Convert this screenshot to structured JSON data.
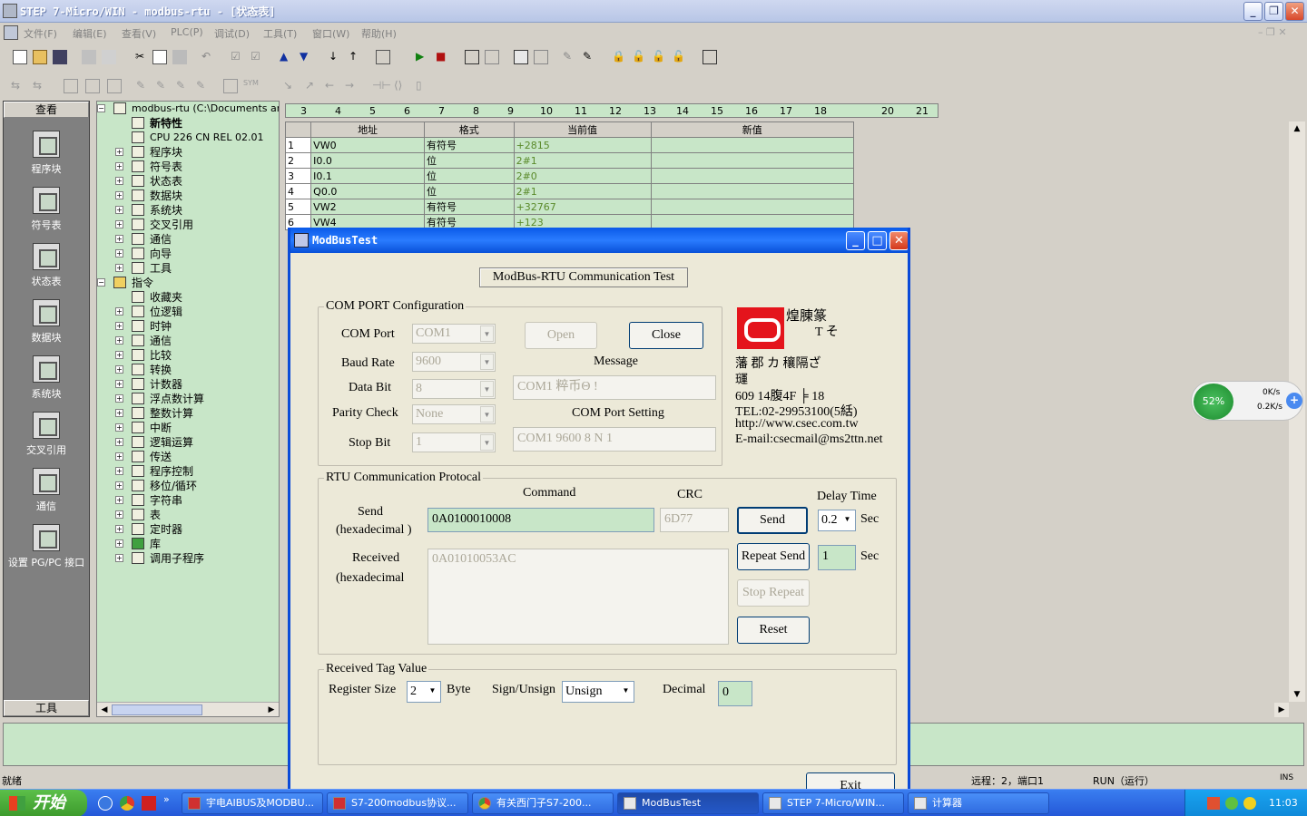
{
  "app": {
    "title": "STEP 7-Micro/WIN - modbus-rtu - [状态表]",
    "menu": [
      "文件(F)",
      "编辑(E)",
      "查看(V)",
      "PLC(P)",
      "调试(D)",
      "工具(T)",
      "窗口(W)",
      "帮助(H)"
    ]
  },
  "navbar": {
    "header": "查看",
    "footer": "工具",
    "items": [
      "程序块",
      "符号表",
      "状态表",
      "数据块",
      "系统块",
      "交叉引用",
      "通信",
      "设置 PG/PC 接口"
    ]
  },
  "tree": {
    "root": "modbus-rtu (C:\\Documents and S",
    "nodes": [
      "新特性",
      "CPU 226 CN REL 02.01",
      "程序块",
      "符号表",
      "状态表",
      "数据块",
      "系统块",
      "交叉引用",
      "通信",
      "向导",
      "工具",
      "指令",
      "收藏夹",
      "位逻辑",
      "时钟",
      "通信",
      "比较",
      "转换",
      "计数器",
      "浮点数计算",
      "整数计算",
      "中断",
      "逻辑运算",
      "传送",
      "程序控制",
      "移位/循环",
      "字符串",
      "表",
      "定时器",
      "库",
      "调用子程序"
    ]
  },
  "ruler": [
    "3",
    "4",
    "5",
    "6",
    "7",
    "8",
    "9",
    "10",
    "11",
    "12",
    "13",
    "14",
    "15",
    "16",
    "17",
    "18",
    "20",
    "21"
  ],
  "status_table": {
    "headers": [
      "地址",
      "格式",
      "当前值",
      "新值"
    ],
    "rows": [
      {
        "n": "1",
        "addr": "VW0",
        "fmt": "有符号",
        "val": "+2815"
      },
      {
        "n": "2",
        "addr": "I0.0",
        "fmt": "位",
        "val": "2#1"
      },
      {
        "n": "3",
        "addr": "I0.1",
        "fmt": "位",
        "val": "2#0"
      },
      {
        "n": "4",
        "addr": "Q0.0",
        "fmt": "位",
        "val": "2#1"
      },
      {
        "n": "5",
        "addr": "VW2",
        "fmt": "有符号",
        "val": "+32767"
      },
      {
        "n": "6",
        "addr": "VW4",
        "fmt": "有符号",
        "val": "+123"
      }
    ]
  },
  "statusbar": {
    "left": "就绪",
    "remote": "远程：2，端口1",
    "run": "RUN（运行）",
    "ins": "INS"
  },
  "taskbar": {
    "start": "开始",
    "tasks": [
      "宇电AIBUS及MODBU...",
      "S7-200modbus协议...",
      "有关西门子S7-200...",
      "ModBusTest",
      "STEP 7-Micro/WIN...",
      "计算器"
    ],
    "clock": "11:03"
  },
  "netmeter": {
    "percent": "52%",
    "up": "0K/s",
    "down": "0.2K/s"
  },
  "dialog": {
    "title": "ModBusTest",
    "heading": "ModBus-RTU Communication Test",
    "com": {
      "legend": "COM PORT Configuration",
      "labels": [
        "COM Port",
        "Baud Rate",
        "Data Bit",
        "Parity Check",
        "Stop Bit"
      ],
      "values": [
        "COM1",
        "9600",
        "8",
        "None",
        "1"
      ],
      "open": "Open",
      "close": "Close",
      "message_label": "Message",
      "message": "COM1 粹币Θ   !",
      "setting_label": "COM Port Setting",
      "setting": "COM1 9600 8 N 1"
    },
    "company": {
      "name": "煌腖篆",
      "line2": "T    そ",
      "line3": "藩  郡      カ   穰隔ざ",
      "line4": "璭",
      "addr": "609   14腹4F ╞ 18",
      "tel": "TEL:02-29953100(5絬)",
      "web": "http://www.csec.com.tw",
      "email": "E-mail:csecmail@ms2ttn.net"
    },
    "rtu": {
      "legend": "RTU Communication Protocal",
      "command_label": "Command",
      "crc_label": "CRC",
      "delay_label": "Delay Time",
      "send_label": "Send",
      "hex1": "(hexadecimal )",
      "command": "0A0100010008",
      "crc": "6D77",
      "send_btn": "Send",
      "delay": "0.2",
      "sec": "Sec",
      "received_label": "Received",
      "hex2": "(hexadecimal",
      "received": "0A01010053AC",
      "repeat_btn": "Repeat Send",
      "repeat_val": "1",
      "stop_btn": "Stop Repeat",
      "reset_btn": "Reset"
    },
    "tag": {
      "legend": "Received Tag Value",
      "reg_label": "Register Size",
      "reg_val": "2",
      "byte": "Byte",
      "sign_label": "Sign/Unsign",
      "sign_val": "Unsign",
      "dec_label": "Decimal",
      "dec_val": "0"
    },
    "exit": "Exit"
  }
}
